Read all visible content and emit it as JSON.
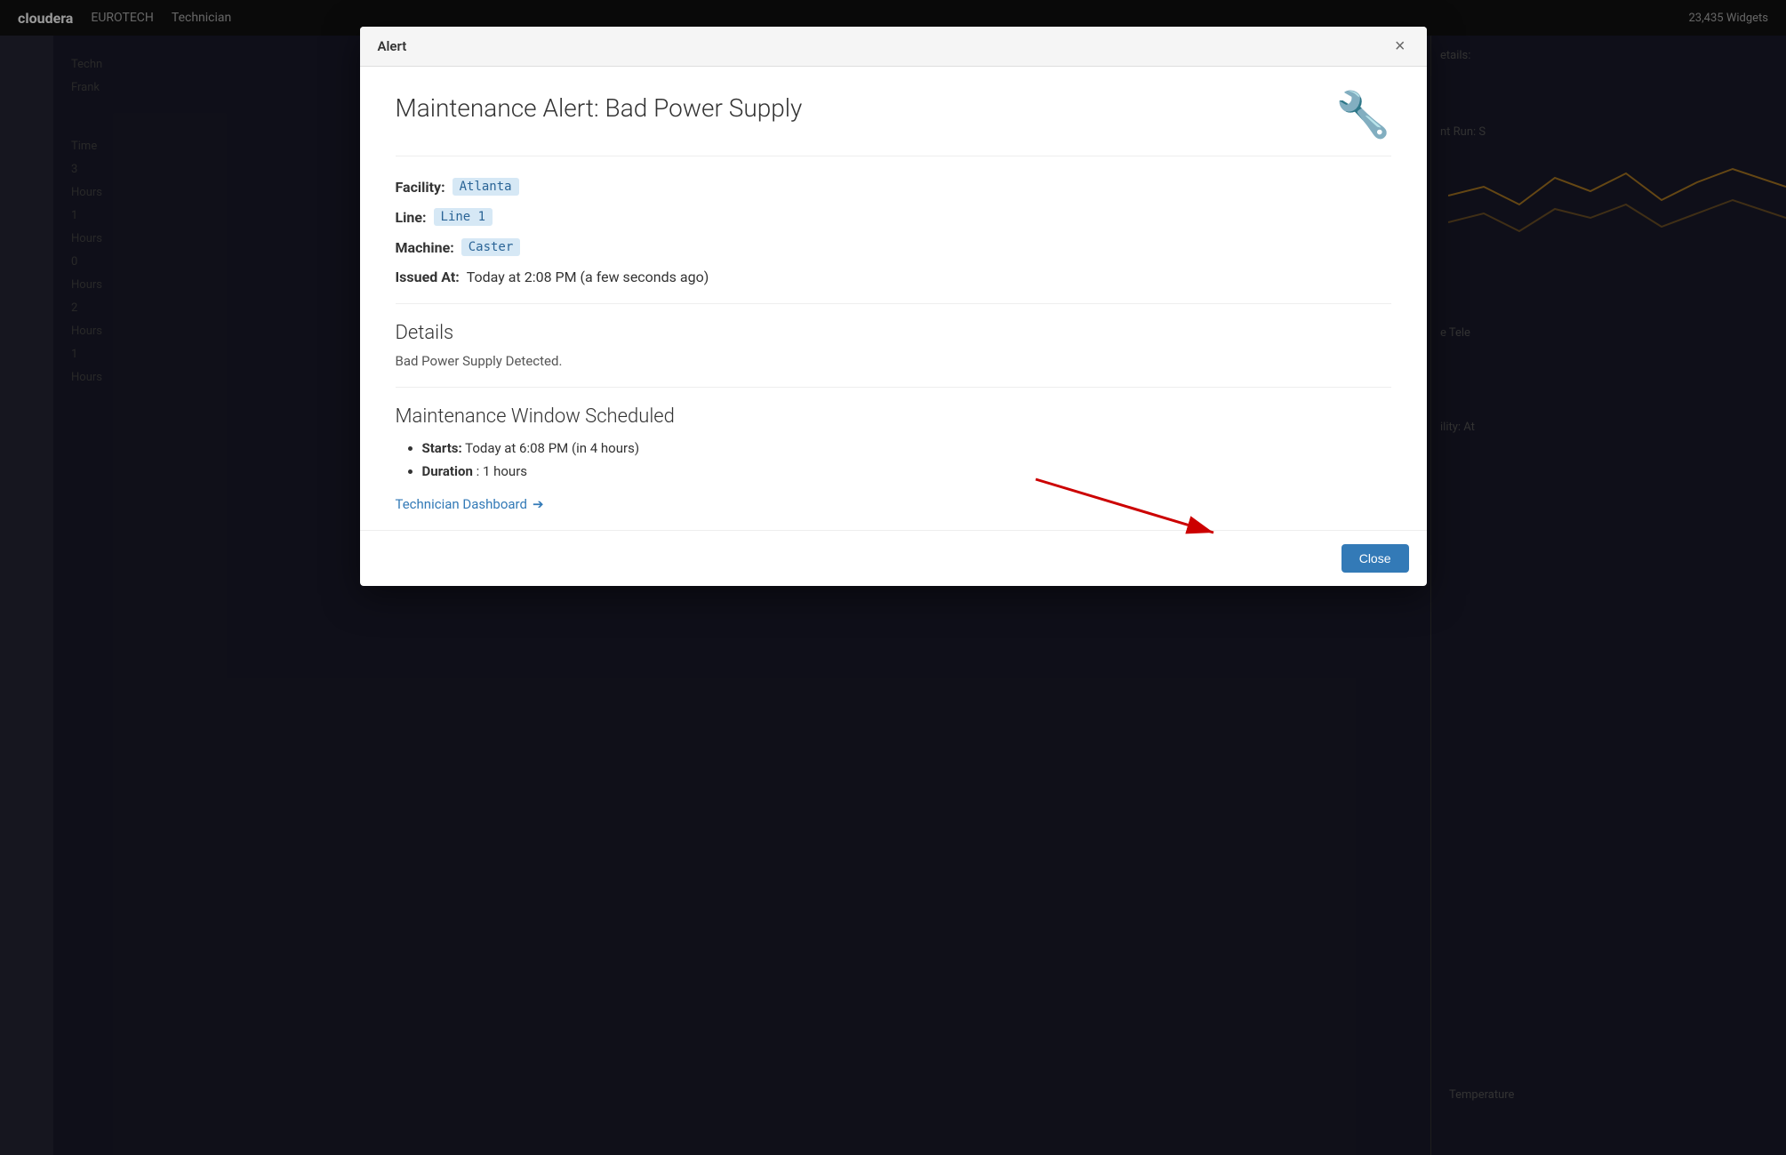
{
  "topbar": {
    "logo": "cloudera",
    "brand": "EUROTECH",
    "nav_label": "Technician",
    "widget_count": "23,435 Widgets"
  },
  "modal": {
    "header_title": "Alert",
    "close_x": "×",
    "main_title": "Maintenance Alert: Bad Power Supply",
    "facility_label": "Facility:",
    "facility_value": "Atlanta",
    "line_label": "Line:",
    "line_value": "Line 1",
    "machine_label": "Machine:",
    "machine_value": "Caster",
    "issued_label": "Issued At:",
    "issued_value": "Today at 2:08 PM (a few seconds ago)",
    "details_heading": "Details",
    "details_text": "Bad Power Supply Detected.",
    "maintenance_heading": "Maintenance Window Scheduled",
    "starts_label": "Starts:",
    "starts_value": "Today at 6:08 PM (in 4 hours)",
    "duration_label": "Duration",
    "duration_value": "1 hours",
    "dashboard_link": "Technician Dashboard",
    "dashboard_link_icon": "➔",
    "close_button": "Close"
  },
  "background": {
    "sidebar_items": [
      "Time",
      "3 Hours",
      "1 Hours",
      "0 Hours",
      "2 Hours",
      "1 Hours"
    ],
    "right_panel_title": "e Tele",
    "right_panel_subtitle": "nt Run: S",
    "right_details": "Facility: At"
  },
  "colors": {
    "accent_blue": "#337ab7",
    "badge_bg": "#d6e8f5",
    "badge_text": "#2a6496",
    "wrench_orange": "#e6a020",
    "close_btn_bg": "#337ab7",
    "arrow_red": "#cc0000"
  }
}
